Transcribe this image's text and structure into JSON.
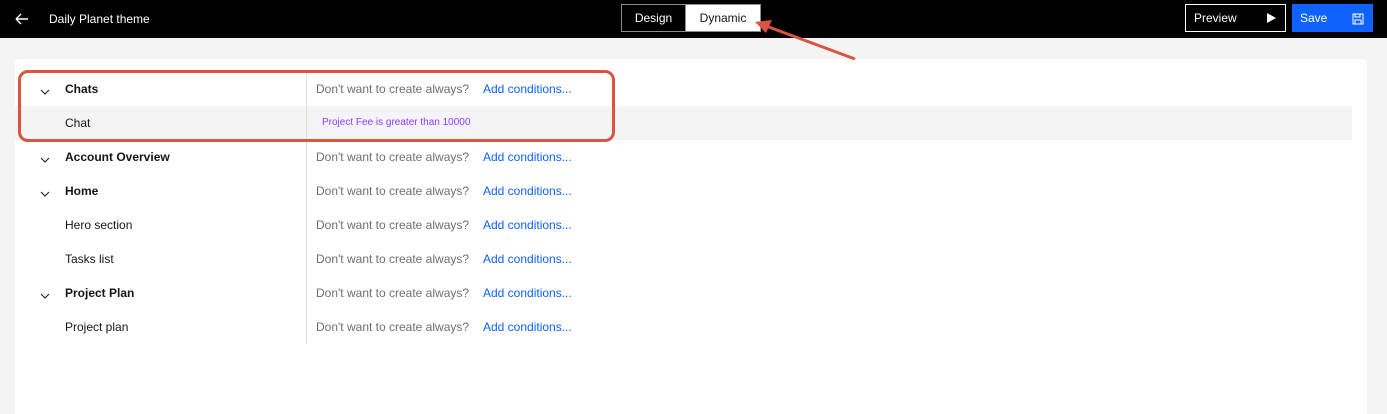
{
  "header": {
    "title": "Daily Planet theme",
    "tabs": [
      {
        "label": "Design",
        "active": false
      },
      {
        "label": "Dynamic",
        "active": true
      }
    ],
    "preview_label": "Preview",
    "save_label": "Save"
  },
  "rows": [
    {
      "label": "Chats",
      "level": "section",
      "hint": "Don't want to create always?",
      "link": "Add conditions..."
    },
    {
      "label": "Chat",
      "level": "item",
      "condition": "Project Fee is greater than 10000",
      "highlight": true
    },
    {
      "label": "Account Overview",
      "level": "section",
      "hint": "Don't want to create always?",
      "link": "Add conditions..."
    },
    {
      "label": "Home",
      "level": "section",
      "hint": "Don't want to create always?",
      "link": "Add conditions..."
    },
    {
      "label": "Hero section",
      "level": "item",
      "hint": "Don't want to create always?",
      "link": "Add conditions..."
    },
    {
      "label": "Tasks list",
      "level": "item",
      "hint": "Don't want to create always?",
      "link": "Add conditions..."
    },
    {
      "label": "Project Plan",
      "level": "section",
      "hint": "Don't want to create always?",
      "link": "Add conditions..."
    },
    {
      "label": "Project plan",
      "level": "item",
      "hint": "Don't want to create always?",
      "link": "Add conditions..."
    }
  ],
  "colors": {
    "accent": "#0f62fe",
    "annotation": "#d9553f",
    "tag_text": "#8a3ffc",
    "tag_bg": "#f6f2ff"
  }
}
